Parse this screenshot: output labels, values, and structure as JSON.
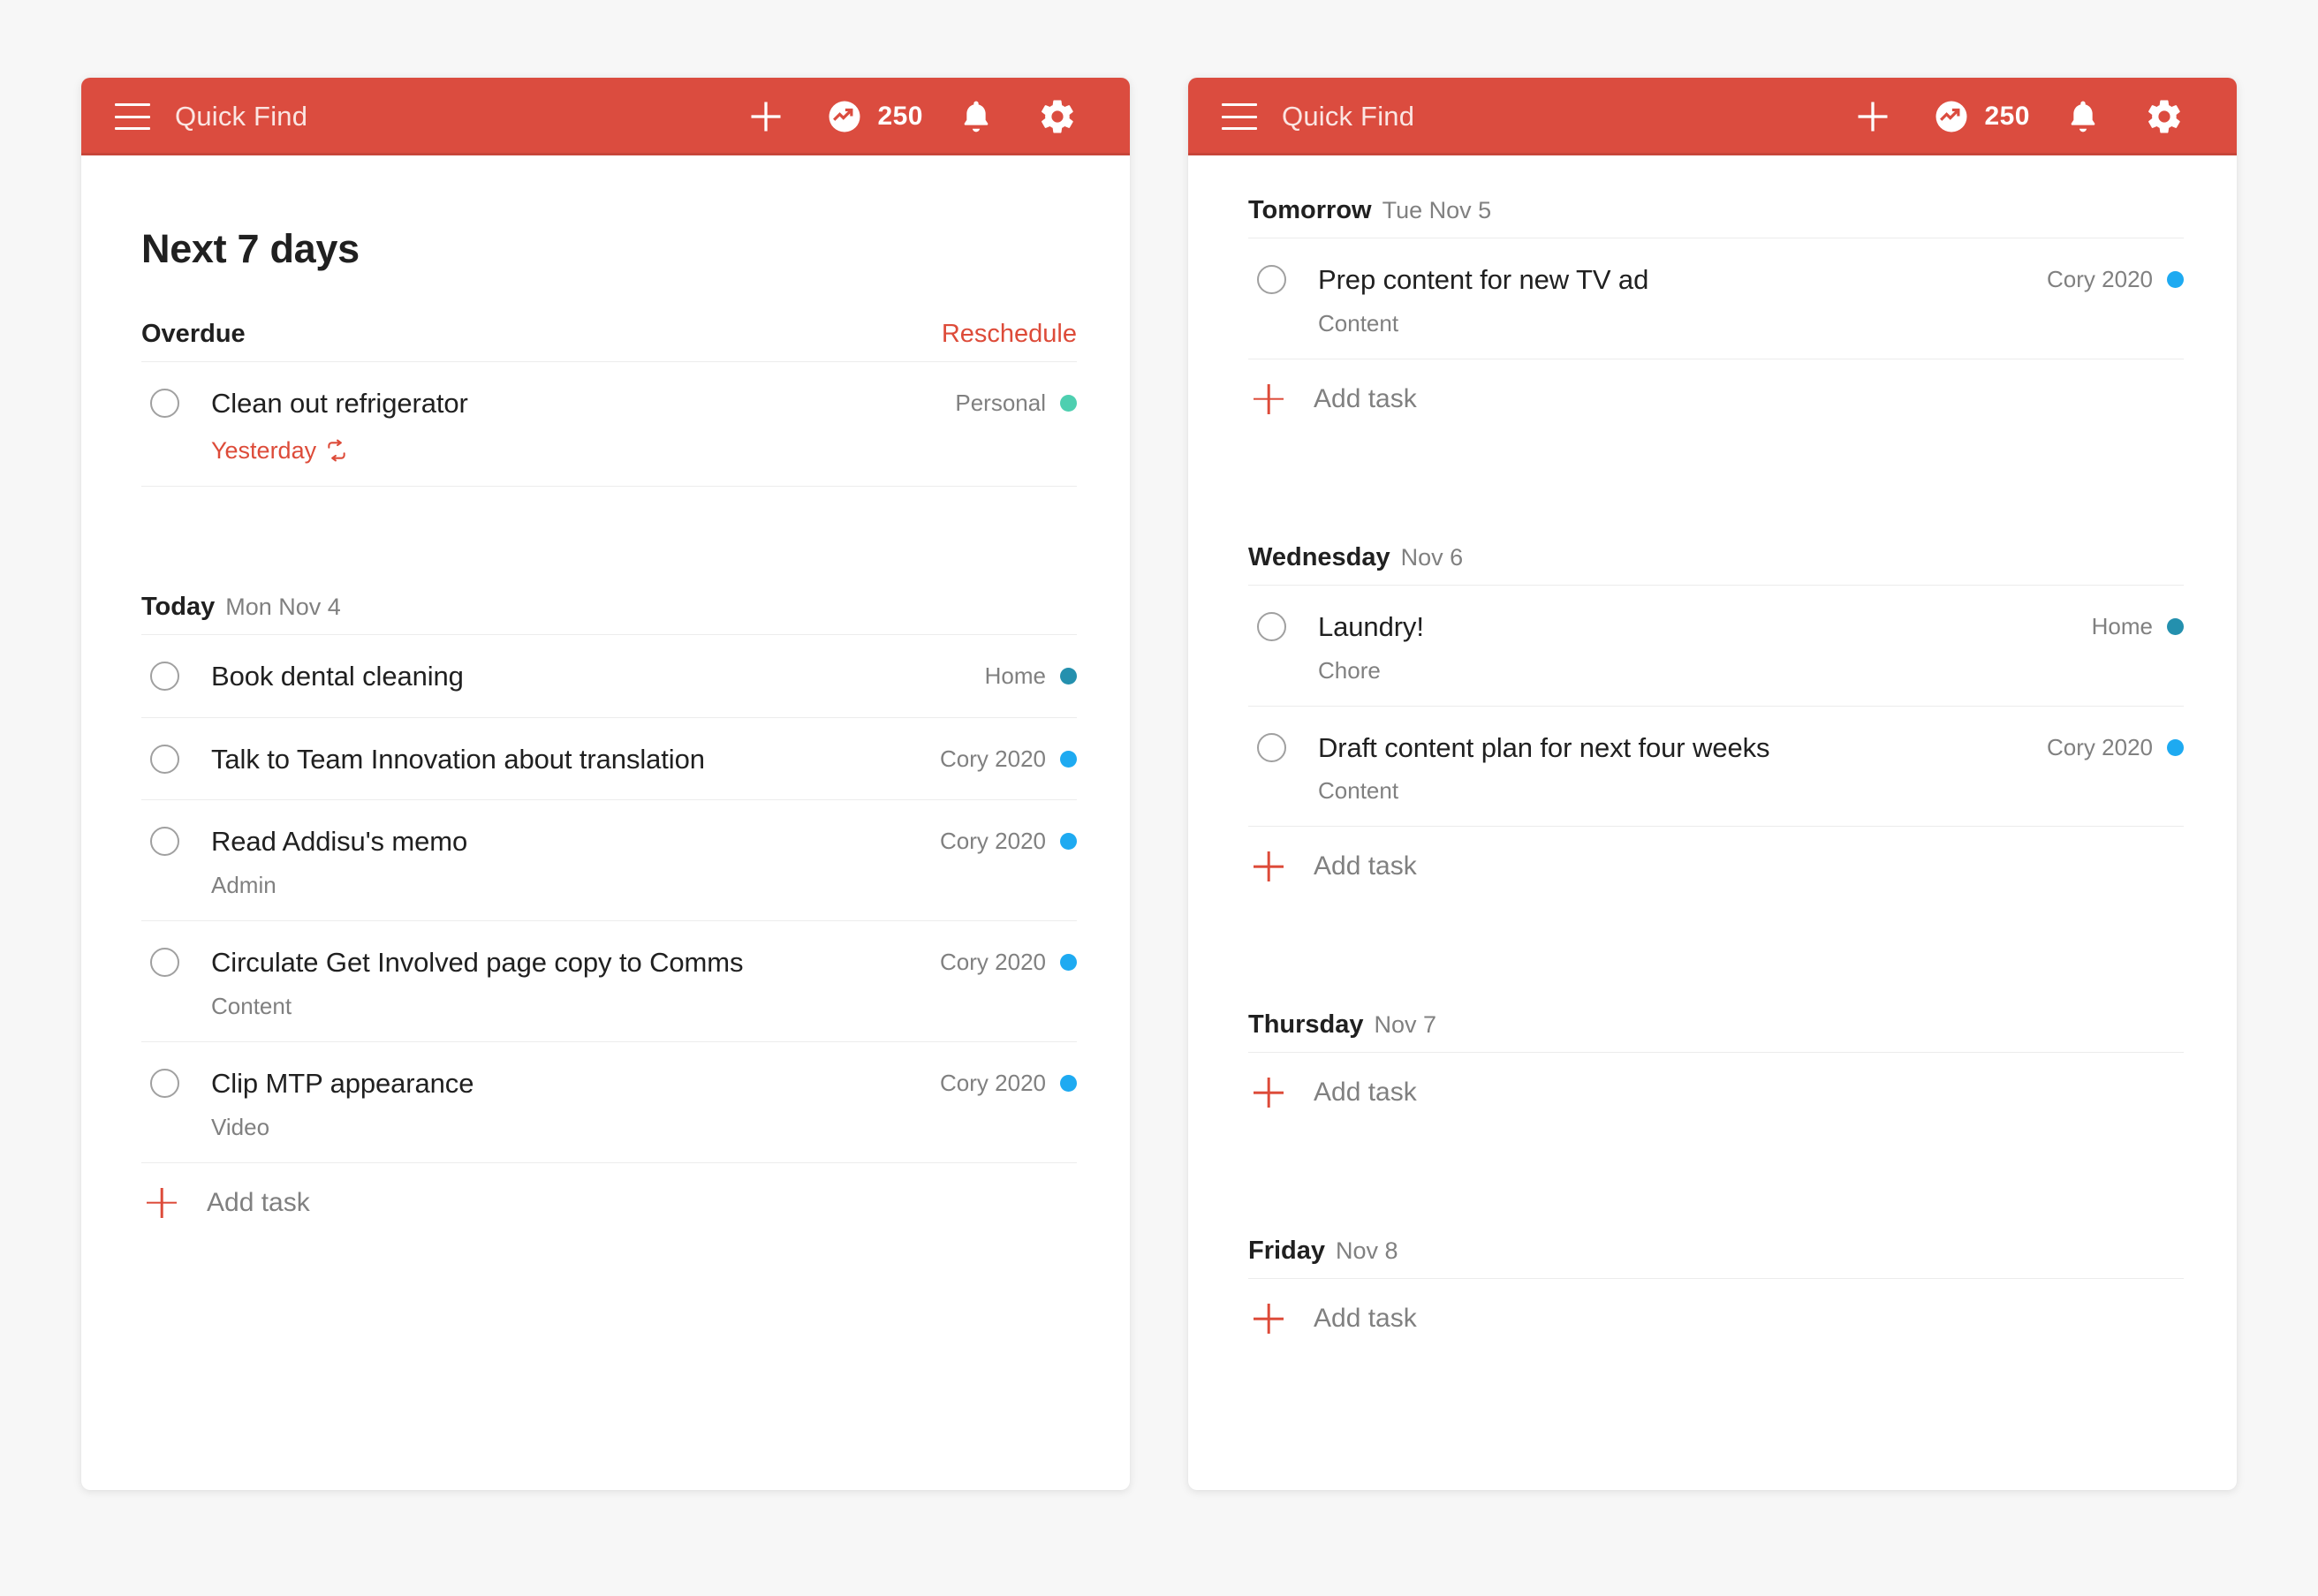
{
  "app": {
    "accent_red": "#db4c3f",
    "action_red": "#dd4b39",
    "background": "#f7f7f7"
  },
  "header": {
    "menu_icon": "hamburger-menu-icon",
    "quick_find": "Quick Find",
    "add_icon": "plus-icon",
    "karma_icon": "karma-trending-up-icon",
    "karma_count": "250",
    "notifications_icon": "bell-icon",
    "settings_icon": "gear-icon"
  },
  "left_panel": {
    "title": "Next 7 days",
    "sections": [
      {
        "title": "Overdue",
        "date": "",
        "action": "Reschedule",
        "tasks": [
          {
            "title": "Clean out refrigerator",
            "sub": "",
            "due": "Yesterday",
            "recurring": true,
            "project": "Personal",
            "color": "#4ecfb0"
          }
        ],
        "add_task": ""
      },
      {
        "title": "Today",
        "date": "Mon Nov 4",
        "action": "",
        "tasks": [
          {
            "title": "Book dental cleaning",
            "sub": "",
            "due": "",
            "recurring": false,
            "project": "Home",
            "color": "#2490ae"
          },
          {
            "title": "Talk to Team Innovation about translation",
            "sub": "",
            "due": "",
            "recurring": false,
            "project": "Cory 2020",
            "color": "#1eaaf1"
          },
          {
            "title": "Read Addisu's memo",
            "sub": "Admin",
            "due": "",
            "recurring": false,
            "project": "Cory 2020",
            "color": "#1eaaf1"
          },
          {
            "title": "Circulate Get Involved page copy to Comms",
            "sub": "Content",
            "due": "",
            "recurring": false,
            "project": "Cory 2020",
            "color": "#1eaaf1"
          },
          {
            "title": "Clip MTP appearance",
            "sub": "Video",
            "due": "",
            "recurring": false,
            "project": "Cory 2020",
            "color": "#1eaaf1"
          }
        ],
        "add_task": "Add task"
      }
    ]
  },
  "right_panel": {
    "sections": [
      {
        "title": "Tomorrow",
        "date": "Tue Nov 5",
        "action": "",
        "tasks": [
          {
            "title": "Prep content for new TV ad",
            "sub": "Content",
            "due": "",
            "recurring": false,
            "project": "Cory 2020",
            "color": "#1eaaf1"
          }
        ],
        "add_task": "Add task"
      },
      {
        "title": "Wednesday",
        "date": "Nov 6",
        "action": "",
        "tasks": [
          {
            "title": "Laundry!",
            "sub": "Chore",
            "due": "",
            "recurring": false,
            "project": "Home",
            "color": "#2490ae"
          },
          {
            "title": "Draft content plan for next four weeks",
            "sub": "Content",
            "due": "",
            "recurring": false,
            "project": "Cory 2020",
            "color": "#1eaaf1"
          }
        ],
        "add_task": "Add task"
      },
      {
        "title": "Thursday",
        "date": "Nov 7",
        "action": "",
        "tasks": [],
        "add_task": "Add task"
      },
      {
        "title": "Friday",
        "date": "Nov 8",
        "action": "",
        "tasks": [],
        "add_task": "Add task"
      }
    ]
  }
}
